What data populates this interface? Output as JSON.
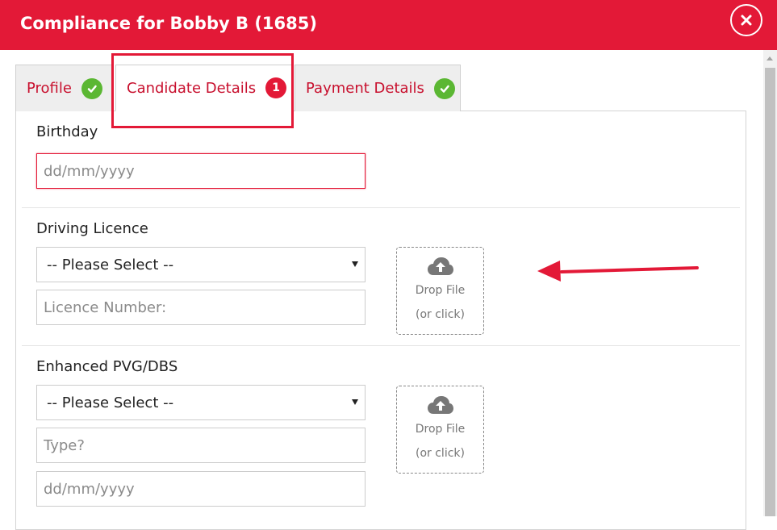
{
  "modal": {
    "title": "Compliance for Bobby B (1685)",
    "close_icon": "close-icon",
    "accent_color": "#e31937"
  },
  "tabs": [
    {
      "label": "Profile",
      "status": "complete",
      "icon": "check-icon"
    },
    {
      "label": "Candidate Details",
      "status": "incomplete",
      "count": "1"
    },
    {
      "label": "Payment Details",
      "status": "complete",
      "icon": "check-icon"
    }
  ],
  "birthday": {
    "label": "Birthday",
    "placeholder": "dd/mm/yyyy",
    "value": ""
  },
  "driving_licence": {
    "label": "Driving Licence",
    "select_value": "-- Please Select --",
    "number_placeholder": "Licence Number:",
    "dropzone": {
      "line1": "Drop File",
      "line2": "(or click)",
      "icon": "cloud-upload-icon"
    }
  },
  "pvg_dbs": {
    "label": "Enhanced PVG/DBS",
    "select_value": "-- Please Select --",
    "type_placeholder": "Type?",
    "date_placeholder": "dd/mm/yyyy",
    "dropzone": {
      "line1": "Drop File",
      "line2": "(or click)",
      "icon": "cloud-upload-icon"
    }
  },
  "annotations": {
    "highlight_color": "#e31937",
    "arrow_icon": "left-arrow-icon"
  }
}
